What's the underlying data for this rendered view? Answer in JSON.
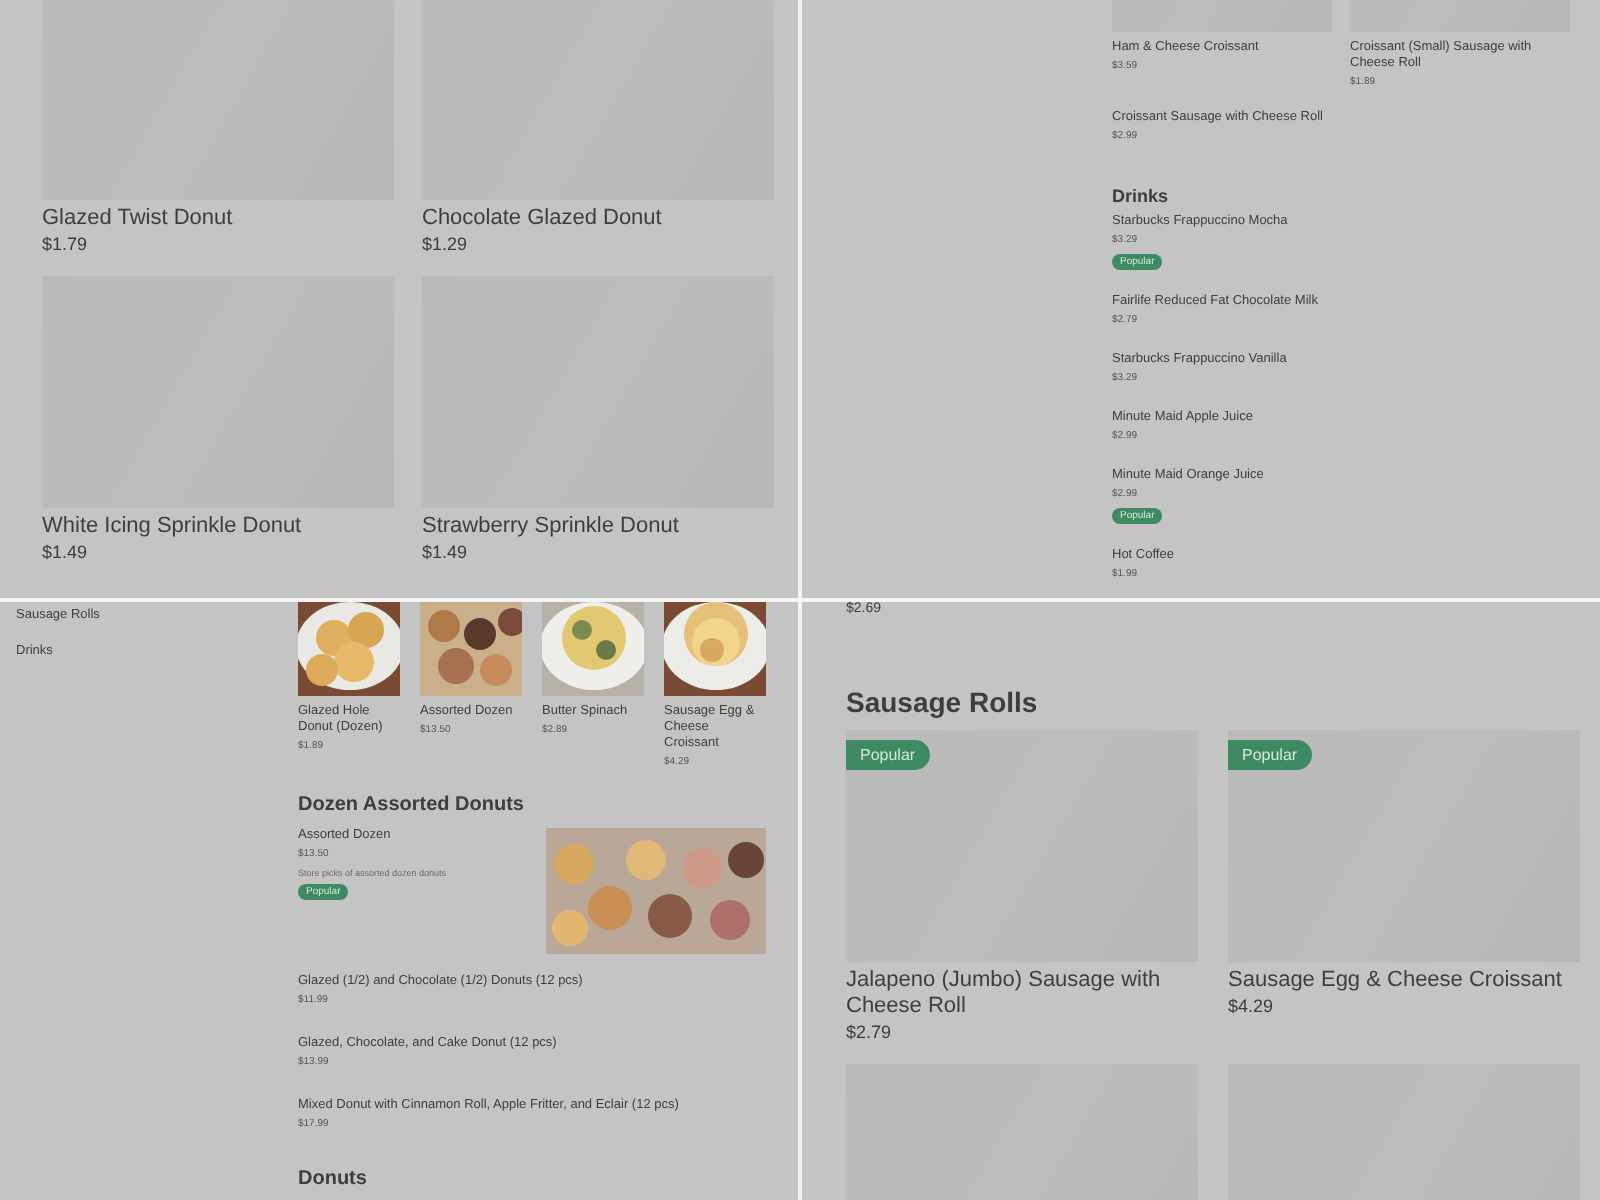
{
  "panels": [
    {
      "kind": "grid",
      "blocks": [
        {
          "kind": "big_cards",
          "cards": [
            {
              "title": "Glazed Twist Donut",
              "price": "$1.79",
              "popular": false
            },
            {
              "title": "Chocolate Glazed Donut",
              "price": "$1.29",
              "popular": false
            },
            {
              "title": "White Icing Sprinkle Donut",
              "price": "$1.49",
              "popular": false
            },
            {
              "title": "Strawberry Sprinkle Donut",
              "price": "$1.49",
              "popular": false
            }
          ]
        }
      ]
    },
    {
      "kind": "menu",
      "blocks": [
        {
          "kind": "small_cards",
          "cards": [
            {
              "title": "Ham & Cheese Croissant",
              "price": "$3.59"
            },
            {
              "title": "Croissant (Small) Sausage with Cheese Roll",
              "price": "$1.89"
            }
          ]
        },
        {
          "kind": "item",
          "name": "Croissant Sausage with Cheese Roll",
          "price": "$2.99",
          "popular": false
        },
        {
          "kind": "heading",
          "text": "Drinks"
        },
        {
          "kind": "item",
          "name": "Starbucks Frappuccino Mocha",
          "price": "$3.29",
          "popular": true,
          "badge": "Popular"
        },
        {
          "kind": "item",
          "name": "Fairlife Reduced Fat Chocolate Milk",
          "price": "$2.79",
          "popular": false
        },
        {
          "kind": "item",
          "name": "Starbucks Frappuccino Vanilla",
          "price": "$3.29",
          "popular": false
        },
        {
          "kind": "item",
          "name": "Minute Maid Apple Juice",
          "price": "$2.99",
          "popular": false
        },
        {
          "kind": "item",
          "name": "Minute Maid Orange Juice",
          "price": "$2.99",
          "popular": true,
          "badge": "Popular"
        },
        {
          "kind": "item",
          "name": "Hot Coffee",
          "price": "$1.99",
          "popular": false
        }
      ]
    },
    {
      "kind": "sidebar",
      "sidebar": {
        "items": [
          {
            "label": "Sausage Rolls"
          },
          {
            "label": "Drinks"
          }
        ]
      },
      "blocks": [
        {
          "kind": "photo_cards",
          "cards": [
            {
              "title": "Glazed Hole Donut (Dozen)",
              "price": "$1.89"
            },
            {
              "title": "Assorted Dozen",
              "price": "$13.50"
            },
            {
              "title": "Butter Spinach",
              "price": "$2.89"
            },
            {
              "title": "Sausage Egg & Cheese Croissant",
              "price": "$4.29"
            }
          ]
        },
        {
          "kind": "heading",
          "text": "Dozen Assorted Donuts"
        },
        {
          "kind": "featured",
          "name": "Assorted Dozen",
          "price": "$13.50",
          "description": "Store picks of assorted dozen donuts",
          "popular": true,
          "badge": "Popular"
        },
        {
          "kind": "item",
          "name": "Glazed (1/2) and Chocolate (1/2) Donuts (12 pcs)",
          "price": "$11.99",
          "popular": false
        },
        {
          "kind": "item",
          "name": "Glazed, Chocolate, and Cake Donut (12 pcs)",
          "price": "$13.99",
          "popular": false
        },
        {
          "kind": "item",
          "name": "Mixed Donut with Cinnamon Roll, Apple Fritter, and Eclair (12 pcs)",
          "price": "$17.99",
          "popular": false
        },
        {
          "kind": "heading",
          "text": "Donuts"
        }
      ]
    },
    {
      "kind": "section",
      "blocks": [
        {
          "kind": "price",
          "text": "$2.69"
        },
        {
          "kind": "heading",
          "text": "Sausage Rolls"
        },
        {
          "kind": "big_cards",
          "cards": [
            {
              "title": "Jalapeno (Jumbo) Sausage with Cheese Roll",
              "price": "$2.79",
              "popular": true,
              "badge": "Popular"
            },
            {
              "title": "Sausage Egg & Cheese Croissant",
              "price": "$4.29",
              "popular": true,
              "badge": "Popular"
            },
            {
              "popular": false
            },
            {
              "popular": false
            }
          ]
        }
      ]
    }
  ]
}
